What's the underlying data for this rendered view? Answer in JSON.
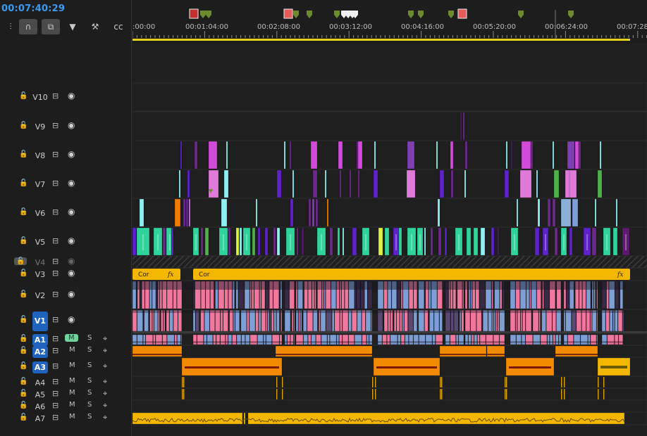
{
  "timecode": "00:07:40:29",
  "ruler_labels": [
    ":00:00",
    "00:01:04:00",
    "00:02:08:00",
    "00:03:12:00",
    "00:04:16:00",
    "00:05:20:00",
    "00:06:24:00",
    "00:07:28:00"
  ],
  "toolbar": [
    {
      "icon": "insert-sequence-icon",
      "active": false
    },
    {
      "icon": "snap-magnet-icon",
      "active": true
    },
    {
      "icon": "linked-selection-icon",
      "active": true
    },
    {
      "icon": "add-marker-icon",
      "active": false
    },
    {
      "icon": "wrench-settings-icon",
      "active": false
    },
    {
      "icon": "captions-icon",
      "active": false
    }
  ],
  "video_tracks": [
    {
      "name": "V10",
      "source": false
    },
    {
      "name": "V9",
      "source": false
    },
    {
      "name": "V8",
      "source": false
    },
    {
      "name": "V7",
      "source": false
    },
    {
      "name": "V6",
      "source": false
    },
    {
      "name": "V5",
      "source": false
    },
    {
      "name": "V4",
      "source": false,
      "locked": true
    },
    {
      "name": "V3",
      "source": false
    },
    {
      "name": "V2",
      "source": false
    },
    {
      "name": "V1",
      "source": true
    }
  ],
  "audio_tracks": [
    {
      "name": "A1",
      "source": true,
      "mute_active": true
    },
    {
      "name": "A2",
      "source": true,
      "mute_active": false
    },
    {
      "name": "A3",
      "source": true,
      "mute_active": false
    },
    {
      "name": "A4",
      "source": false,
      "mute_active": false
    },
    {
      "name": "A5",
      "source": false,
      "mute_active": false
    },
    {
      "name": "A6",
      "source": false,
      "mute_active": false
    },
    {
      "name": "A7",
      "source": false,
      "mute_active": false
    }
  ],
  "track_buttons": {
    "mute": "M",
    "solo": "S"
  },
  "adjustment_clips": [
    {
      "label": "Cor",
      "fx": "fx"
    },
    {
      "label": "Cor",
      "fx": "fx"
    }
  ],
  "colors": {
    "timecode": "#3a9bf0",
    "work_area": "#e6d21a",
    "adjustment": "#f4b700",
    "audio_orange": "#f28a00",
    "audio_yellow": "#f4b700",
    "v1_pink": "#f0789e",
    "v1_blue": "#7e9ed6",
    "green": "#2fd39b",
    "magenta": "#d14ad8",
    "cyan": "#8ff0f4",
    "purple": "#5d22c8",
    "source_patch": "#1f63bf"
  }
}
